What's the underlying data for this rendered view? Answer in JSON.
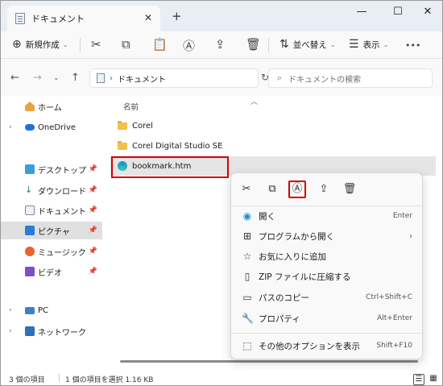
{
  "window": {
    "tab_title": "ドキュメント",
    "tab_close": "✕",
    "new_tab": "+",
    "minimize": "—",
    "maximize": "☐",
    "close": "✕"
  },
  "toolbar": {
    "new_label": "新規作成",
    "sort_label": "並べ替え",
    "view_label": "表示",
    "more": "•••"
  },
  "nav": {
    "breadcrumb": "ドキュメント",
    "search_placeholder": "ドキュメントの検索"
  },
  "sidebar": {
    "items": [
      {
        "label": "ホーム"
      },
      {
        "label": "OneDrive"
      },
      {
        "label": "デスクトップ"
      },
      {
        "label": "ダウンロード"
      },
      {
        "label": "ドキュメント"
      },
      {
        "label": "ピクチャ"
      },
      {
        "label": "ミュージック"
      },
      {
        "label": "ビデオ"
      },
      {
        "label": "PC"
      },
      {
        "label": "ネットワーク"
      }
    ]
  },
  "files": {
    "column_name": "名前",
    "rows": [
      {
        "name": "Corel"
      },
      {
        "name": "Corel Digital Studio SE"
      },
      {
        "name": "bookmark.htm"
      }
    ]
  },
  "context_menu": {
    "items": [
      {
        "label": "開く",
        "shortcut": "Enter"
      },
      {
        "label": "プログラムから開く",
        "shortcut": "›"
      },
      {
        "label": "お気に入りに追加",
        "shortcut": ""
      },
      {
        "label": "ZIP ファイルに圧縮する",
        "shortcut": ""
      },
      {
        "label": "パスのコピー",
        "shortcut": "Ctrl+Shift+C"
      },
      {
        "label": "プロパティ",
        "shortcut": "Alt+Enter"
      },
      {
        "label": "その他のオプションを表示",
        "shortcut": "Shift+F10"
      }
    ]
  },
  "status": {
    "item_count": "3 個の項目",
    "selection": "1 個の項目を選択  1.16 KB"
  },
  "colors": {
    "highlight_border": "#d60000",
    "titlebar_bg": "#e9eef5",
    "folder": "#f0c24b"
  }
}
